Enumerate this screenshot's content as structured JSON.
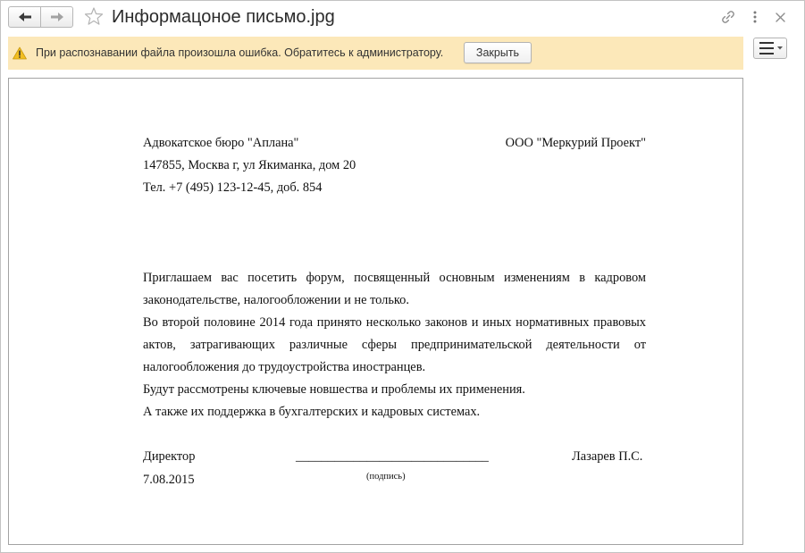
{
  "window": {
    "title": "Информацоное письмо.jpg"
  },
  "toolbar": {
    "back_icon": "arrow-left-icon",
    "forward_icon": "arrow-right-icon",
    "favorite_icon": "star-icon",
    "link_icon": "link-icon",
    "more_icon": "more-vertical-icon",
    "close_icon": "close-icon",
    "menu_icon": "hamburger-menu-icon"
  },
  "notification": {
    "icon": "warning-icon",
    "message": "При распознавании файла произошла ошибка. Обратитесь к администратору.",
    "close_label": "Закрыть"
  },
  "document": {
    "sender": {
      "name": "Адвокатское бюро \"Аплана\"",
      "address": "147855, Москва г, ул Якиманка, дом 20",
      "phone": "Тел. +7 (495) 123-12-45, доб. 854"
    },
    "recipient": "ООО \"Меркурий Проект\"",
    "body_lines": [
      "Приглашаем вас посетить форум, посвященный основным изменениям в кадровом",
      "законодательстве, налогообложении и не только.",
      "Во второй половине 2014 года принято несколько законов и иных нормативных правовых",
      "актов, затрагивающих различные сферы предпринимательской деятельности от",
      "налогообложения до трудоустройства иностранцев.",
      "Будут рассмотрены ключевые новшества и проблемы их применения.",
      "А также их поддержка в бухгалтерских и кадровых системах."
    ],
    "signature": {
      "position": "Директор",
      "line": "______________________________",
      "caption": "(подпись)",
      "name": "Лазарев П.С.",
      "date": "7.08.2015"
    }
  },
  "colors": {
    "notification_background": "#fce8b9",
    "warning_icon": "#f2be22",
    "title_text": "#2b2b2b",
    "document_text": "#111111",
    "frame_border": "#a3a3a3"
  }
}
